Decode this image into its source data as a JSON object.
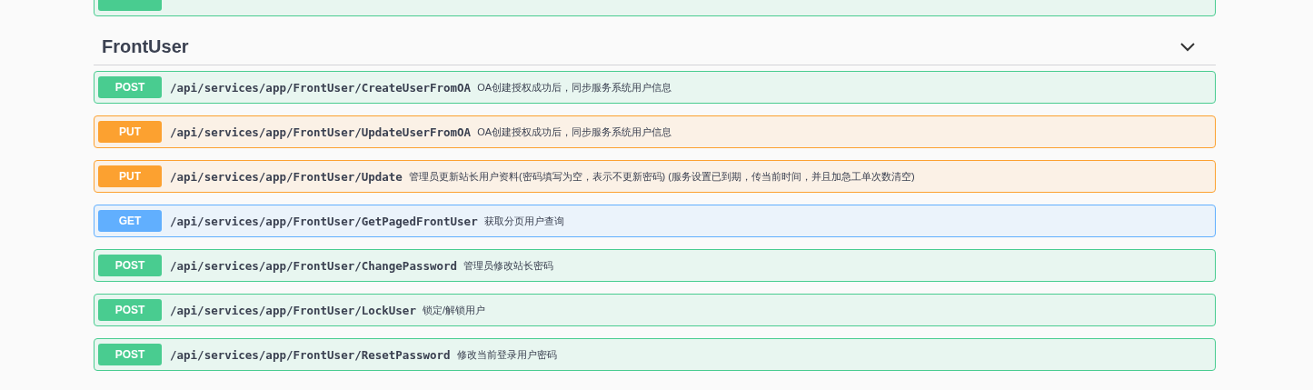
{
  "previous_operation": {
    "kind": "post"
  },
  "section": {
    "title": "FrontUser",
    "expanded": true,
    "operations": [
      {
        "method": "POST",
        "path": "/api/services/app/FrontUser/CreateUserFromOA",
        "summary": "OA创建授权成功后，同步服务系统用户信息"
      },
      {
        "method": "PUT",
        "path": "/api/services/app/FrontUser/UpdateUserFromOA",
        "summary": "OA创建授权成功后，同步服务系统用户信息"
      },
      {
        "method": "PUT",
        "path": "/api/services/app/FrontUser/Update",
        "summary": "管理员更新站长用户资料(密码填写为空，表示不更新密码) (服务设置已到期，传当前时间，并且加急工单次数清空)"
      },
      {
        "method": "GET",
        "path": "/api/services/app/FrontUser/GetPagedFrontUser",
        "summary": "获取分页用户查询"
      },
      {
        "method": "POST",
        "path": "/api/services/app/FrontUser/ChangePassword",
        "summary": "管理员修改站长密码"
      },
      {
        "method": "POST",
        "path": "/api/services/app/FrontUser/LockUser",
        "summary": "锁定/解锁用户"
      },
      {
        "method": "POST",
        "path": "/api/services/app/FrontUser/ResetPassword",
        "summary": "修改当前登录用户密码"
      }
    ]
  }
}
